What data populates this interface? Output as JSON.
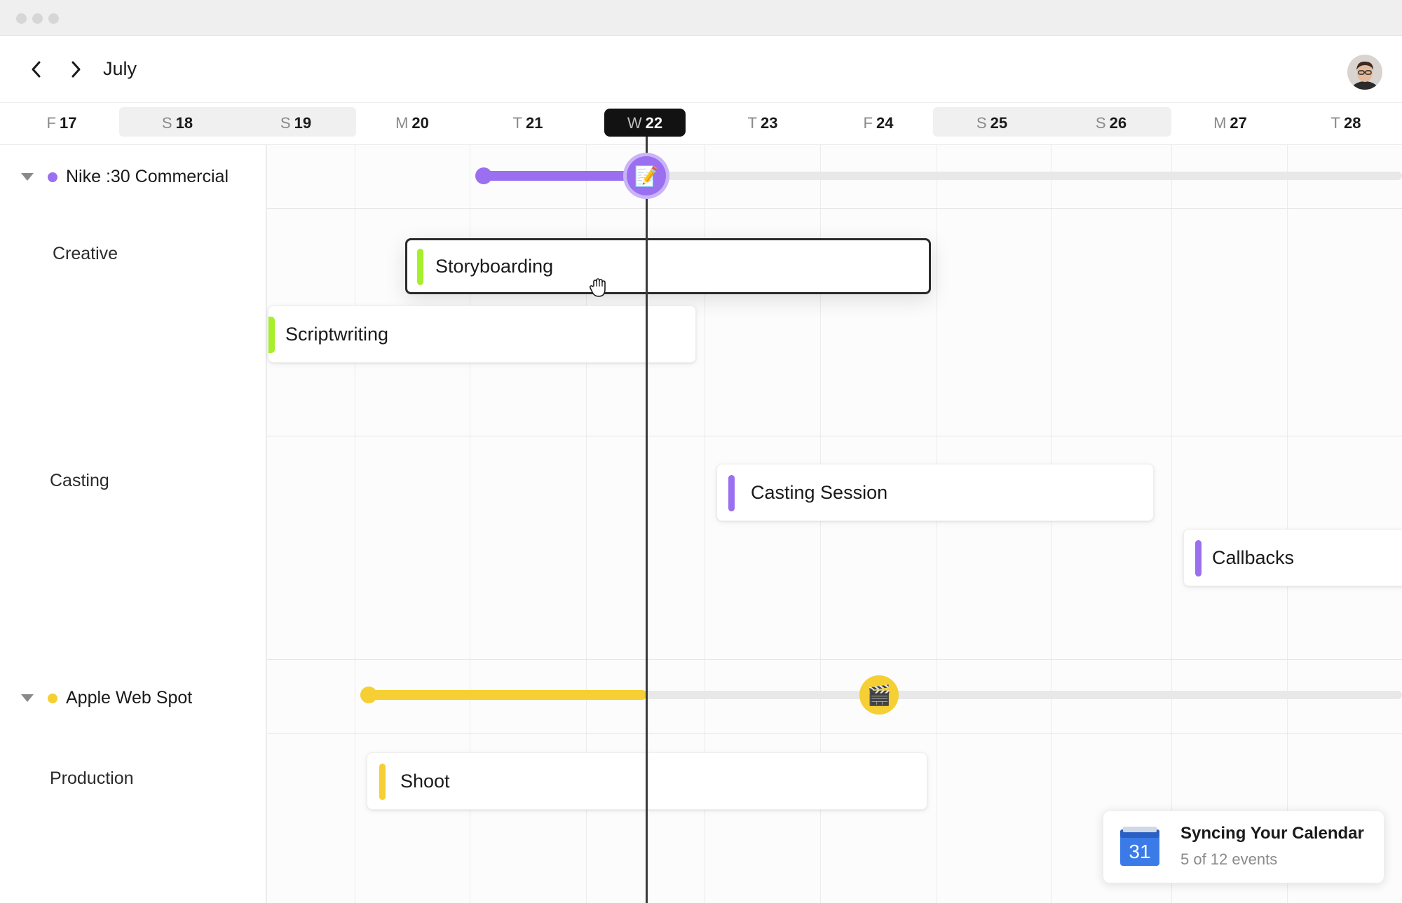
{
  "header": {
    "month": "July"
  },
  "days": [
    {
      "letter": "F",
      "num": "17"
    },
    {
      "letter": "S",
      "num": "18"
    },
    {
      "letter": "S",
      "num": "19"
    },
    {
      "letter": "M",
      "num": "20"
    },
    {
      "letter": "T",
      "num": "21"
    },
    {
      "letter": "W",
      "num": "22"
    },
    {
      "letter": "T",
      "num": "23"
    },
    {
      "letter": "F",
      "num": "24"
    },
    {
      "letter": "S",
      "num": "25"
    },
    {
      "letter": "S",
      "num": "26"
    },
    {
      "letter": "M",
      "num": "27"
    },
    {
      "letter": "T",
      "num": "28"
    }
  ],
  "projects": [
    {
      "name": "Nike :30 Commercial",
      "color": "#9a6ff0",
      "milestone_icon": "memo-icon",
      "milestone_glyph": "📝",
      "sections": [
        {
          "label": "Creative"
        },
        {
          "label": "Casting"
        }
      ],
      "tasks": [
        {
          "label": "Storyboarding",
          "color": "#a6ef2b"
        },
        {
          "label": "Scriptwriting",
          "color": "#a6ef2b"
        },
        {
          "label": "Casting Session",
          "color": "#9a6ff0"
        },
        {
          "label": "Callbacks",
          "color": "#9a6ff0"
        }
      ]
    },
    {
      "name": "Apple Web Spot",
      "color": "#f5cf33",
      "milestone_icon": "clapperboard-icon",
      "milestone_glyph": "🎬",
      "sections": [
        {
          "label": "Production"
        }
      ],
      "tasks": [
        {
          "label": "Shoot",
          "color": "#f5cf33"
        }
      ]
    }
  ],
  "toast": {
    "title": "Syncing Your Calendar",
    "subtitle": "5 of 12 events",
    "icon_number": "31"
  }
}
